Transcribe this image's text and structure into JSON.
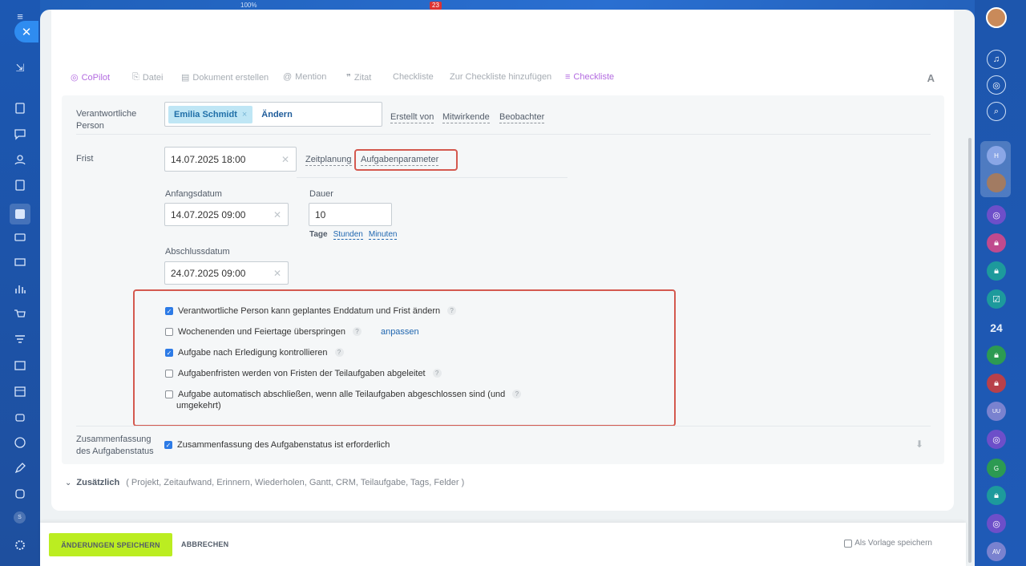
{
  "topstrip": {
    "zoom": "100%",
    "badge": "23"
  },
  "toolbar": {
    "copilot": "CoPilot",
    "datei": "Datei",
    "dokument": "Dokument erstellen",
    "mention": "Mention",
    "zitat": "Zitat",
    "checkliste": "Checkliste",
    "zur_checkliste": "Zur Checkliste hinzufügen",
    "checkliste2": "Checkliste",
    "font": "A"
  },
  "responsible": {
    "label_line1": "Verantwortliche",
    "label_line2": "Person",
    "user": "Emilia Schmidt",
    "remove": "×",
    "change": "Ändern",
    "created_by": "Erstellt von",
    "participants": "Mitwirkende",
    "observers": "Beobachter"
  },
  "deadline": {
    "label": "Frist",
    "value": "14.07.2025 18:00",
    "planning": "Zeitplanung",
    "params": "Aufgabenparameter",
    "start_label": "Anfangsdatum",
    "start_value": "14.07.2025 09:00",
    "duration_label": "Dauer",
    "duration_value": "10",
    "unit_days": "Tage",
    "unit_hours": "Stunden",
    "unit_minutes": "Minuten",
    "end_label": "Abschlussdatum",
    "end_value": "24.07.2025 09:00"
  },
  "options": [
    {
      "text": "Verantwortliche Person kann geplantes Enddatum und Frist ändern",
      "checked": true
    },
    {
      "text": "Wochenenden und Feiertage überspringen",
      "checked": false,
      "link": "anpassen"
    },
    {
      "text": "Aufgabe nach Erledigung kontrollieren",
      "checked": true
    },
    {
      "text": "Aufgabenfristen werden von Fristen der Teilaufgaben abgeleitet",
      "checked": false
    },
    {
      "text": "Aufgabe automatisch abschließen, wenn alle Teilaufgaben abgeschlossen sind (und",
      "text2": "umgekehrt)",
      "checked": false
    }
  ],
  "summary": {
    "label_line1": "Zusammenfassung",
    "label_line2": "des Aufgabenstatus",
    "text": "Zusammenfassung des Aufgabenstatus ist erforderlich",
    "checked": true
  },
  "extra": {
    "title": "Zusätzlich",
    "items": "( Projekt,  Zeitaufwand,  Erinnern,  Wiederholen,  Gantt,  CRM,  Teilaufgabe,  Tags,  Felder )"
  },
  "footer": {
    "save": "ÄNDERUNGEN SPEICHERN",
    "cancel": "ABBRECHEN",
    "template": "Als Vorlage speichern"
  },
  "rightbar": {
    "counter": "24",
    "initial_g": "G",
    "initial_uu": "UU",
    "initial_av": "AV",
    "initial_h": "H"
  },
  "leftbar": {
    "badge_s": "S"
  },
  "colors": {
    "accent_green": "#bbed21",
    "highlight_red": "#d4594f",
    "link_blue": "#2067b0",
    "checkbox_blue": "#2d7be6"
  }
}
